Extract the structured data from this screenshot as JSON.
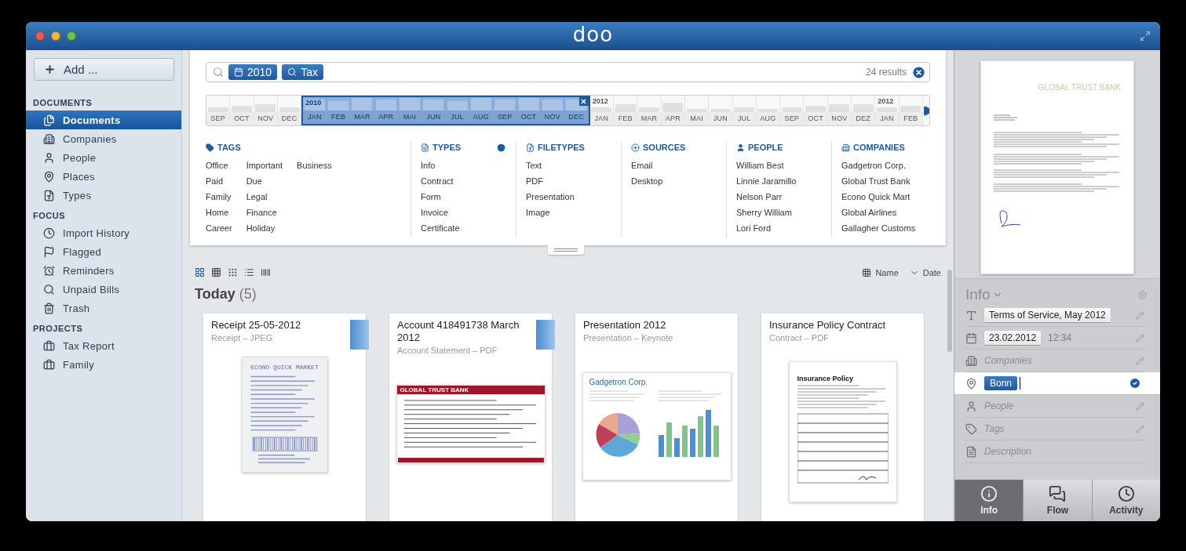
{
  "window": {
    "logo": "doo"
  },
  "sidebar": {
    "add_button": "Add ...",
    "sections": [
      {
        "title": "DOCUMENTS",
        "items": [
          {
            "label": "Documents",
            "selected": true
          },
          {
            "label": "Companies",
            "selected": false
          },
          {
            "label": "People",
            "selected": false
          },
          {
            "label": "Places",
            "selected": false
          },
          {
            "label": "Types",
            "selected": false
          }
        ]
      },
      {
        "title": "FOCUS",
        "items": [
          {
            "label": "Import History",
            "selected": false
          },
          {
            "label": "Flagged",
            "selected": false
          },
          {
            "label": "Reminders",
            "selected": false
          },
          {
            "label": "Unpaid Bills",
            "selected": false
          },
          {
            "label": "Trash",
            "selected": false
          }
        ]
      },
      {
        "title": "PROJECTS",
        "items": [
          {
            "label": "Tax Report",
            "selected": false
          },
          {
            "label": "Family",
            "selected": false
          }
        ]
      }
    ]
  },
  "search": {
    "tokens": [
      {
        "kind": "date",
        "label": "2010"
      },
      {
        "kind": "search",
        "label": "Tax"
      }
    ],
    "results": "24 results"
  },
  "timeline": {
    "months": [
      {
        "label": "SEP",
        "selected": false
      },
      {
        "label": "OCT",
        "selected": false
      },
      {
        "label": "NOV",
        "selected": false
      },
      {
        "label": "DEC",
        "selected": false
      },
      {
        "label": "JAN",
        "selected": true,
        "year": "2010"
      },
      {
        "label": "FEB",
        "selected": true
      },
      {
        "label": "MAR",
        "selected": true
      },
      {
        "label": "APR",
        "selected": true
      },
      {
        "label": "MAI",
        "selected": true
      },
      {
        "label": "JUN",
        "selected": true
      },
      {
        "label": "JUL",
        "selected": true
      },
      {
        "label": "AUG",
        "selected": true
      },
      {
        "label": "SEP",
        "selected": true
      },
      {
        "label": "OCT",
        "selected": true
      },
      {
        "label": "NOV",
        "selected": true
      },
      {
        "label": "DEC",
        "selected": true
      },
      {
        "label": "JAN",
        "selected": false,
        "year": "2012"
      },
      {
        "label": "FEB",
        "selected": false
      },
      {
        "label": "MAR",
        "selected": false
      },
      {
        "label": "APR",
        "selected": false
      },
      {
        "label": "MAI",
        "selected": false
      },
      {
        "label": "JUN",
        "selected": false
      },
      {
        "label": "JUL",
        "selected": false
      },
      {
        "label": "AUG",
        "selected": false
      },
      {
        "label": "SEP",
        "selected": false
      },
      {
        "label": "OCT",
        "selected": false
      },
      {
        "label": "NOV",
        "selected": false
      },
      {
        "label": "DEZ",
        "selected": false
      },
      {
        "label": "JAN",
        "selected": false,
        "year": "2012"
      },
      {
        "label": "FEB",
        "selected": false
      }
    ]
  },
  "facets": [
    {
      "title": "TAGS",
      "columns": [
        [
          "Office",
          "Paid",
          "Family",
          "Home",
          "Career"
        ],
        [
          "Important",
          "Due",
          "Legal",
          "Finance",
          "Holiday"
        ],
        [
          "Business"
        ]
      ]
    },
    {
      "title": "TYPES",
      "more": true,
      "columns": [
        [
          "Info",
          "Contract",
          "Form",
          "Invoice",
          "Certificate"
        ]
      ]
    },
    {
      "title": "FILETYPES",
      "columns": [
        [
          "Text",
          "PDF",
          "Presentation",
          "Image"
        ]
      ]
    },
    {
      "title": "SOURCES",
      "columns": [
        [
          "Email",
          "Desktop"
        ]
      ]
    },
    {
      "title": "PEOPLE",
      "columns": [
        [
          "William Best",
          "Linnie Jaramillo",
          "Nelson Parr",
          "Sherry William",
          "Lori Ford"
        ]
      ]
    },
    {
      "title": "COMPANIES",
      "columns": [
        [
          "Gadgetron Corp.",
          "Global Trust Bank",
          "Econo Quick Mart",
          "Global Airlines",
          "Gallagher Customs"
        ]
      ]
    }
  ],
  "view_modes": [
    {
      "selected": true
    },
    {
      "selected": false
    },
    {
      "selected": false
    },
    {
      "selected": false
    },
    {
      "selected": false
    }
  ],
  "sort": [
    {
      "label": "Name"
    },
    {
      "label": "Date"
    }
  ],
  "group": {
    "title": "Today",
    "count": "(5)"
  },
  "cards": [
    {
      "title": "Receipt 25-05-2012",
      "subtitle": "Receipt  –  JPEG",
      "flagged": true,
      "thumbnail": {
        "kind": "receipt",
        "heading": "ECONO QUICK MARKET"
      }
    },
    {
      "title": "Account 418491738 March 2012",
      "subtitle": "Account Statement  –  PDF",
      "flagged": true,
      "thumbnail": {
        "kind": "statement",
        "heading": "GLOBAL TRUST BANK"
      }
    },
    {
      "title": "Presentation 2012",
      "subtitle": "Presentation  –  Keynote",
      "flagged": false,
      "thumbnail": {
        "kind": "slide",
        "heading": "Gadgetron Corp."
      }
    },
    {
      "title": "Insurance Policy Contract",
      "subtitle": "Contract  –  PDF",
      "flagged": false,
      "thumbnail": {
        "kind": "form",
        "heading": "Insurance Policy"
      }
    }
  ],
  "preview": {
    "heading": "GLOBAL TRUST BANK"
  },
  "info": {
    "title": "Info",
    "rows": [
      {
        "kind": "chip",
        "value": "Terms of Service, May 2012"
      },
      {
        "kind": "date",
        "value": "23.02.2012",
        "time": "12:34"
      },
      {
        "kind": "empty",
        "placeholder": "Companies"
      },
      {
        "kind": "editing",
        "value": "Bonn"
      },
      {
        "kind": "empty",
        "placeholder": "People"
      },
      {
        "kind": "empty",
        "placeholder": "Tags"
      },
      {
        "kind": "note",
        "placeholder": "Description"
      }
    ]
  },
  "bottom_tabs": [
    {
      "label": "Info",
      "selected": true
    },
    {
      "label": "Flow",
      "selected": false
    },
    {
      "label": "Activity",
      "selected": false
    }
  ]
}
